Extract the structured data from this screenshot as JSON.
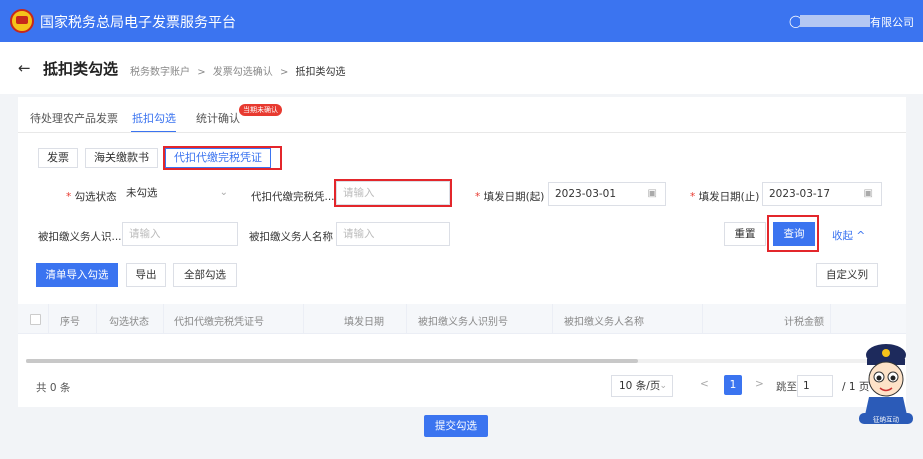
{
  "header": {
    "title": "国家税务总局电子发票服务平台",
    "company_suffix": "有限公司"
  },
  "subheader": {
    "back_glyph": "←",
    "page_title": "抵扣类勾选",
    "breadcrumb": [
      "税务数字账户",
      "发票勾选确认",
      "抵扣类勾选"
    ],
    "separator": ">"
  },
  "tabs": [
    {
      "label": "待处理农产品发票"
    },
    {
      "label": "抵扣勾选"
    },
    {
      "label": "统计确认"
    }
  ],
  "tab_badge": "当期未确认",
  "subtabs": [
    {
      "label": "发票"
    },
    {
      "label": "海关缴款书"
    },
    {
      "label": "代扣代缴完税凭证"
    }
  ],
  "filters": {
    "check_status_label": "勾选状态",
    "check_status_value": "未勾选",
    "voucher_no_label": "代扣代缴完税凭...",
    "voucher_no_placeholder": "请输入",
    "date_from_label": "填发日期(起)",
    "date_from_value": "2023-03-01",
    "date_to_label": "填发日期(止)",
    "date_to_value": "2023-03-17",
    "withholdee_id_label": "被扣缴义务人识...",
    "withholdee_id_placeholder": "请输入",
    "withholdee_name_label": "被扣缴义务人名称",
    "withholdee_name_placeholder": "请输入"
  },
  "actions": {
    "reset": "重置",
    "query": "查询",
    "collapse": "收起",
    "collapse_glyph": "^",
    "import": "清单导入勾选",
    "export": "导出",
    "select_all": "全部勾选",
    "custom_columns": "自定义列"
  },
  "table": {
    "columns": [
      "序号",
      "勾选状态",
      "代扣代缴完税凭证号",
      "填发日期",
      "被扣缴义务人识别号",
      "被扣缴义务人名称",
      "计税金额"
    ],
    "rows": []
  },
  "pagination": {
    "total_text": "共 0 条",
    "page_size": "10 条/页",
    "current_page": "1",
    "jump_label": "跳至",
    "jump_value": "1",
    "total_pages": "/ 1 页"
  },
  "submit": "提交勾选",
  "assistant_label": "征纳互动"
}
